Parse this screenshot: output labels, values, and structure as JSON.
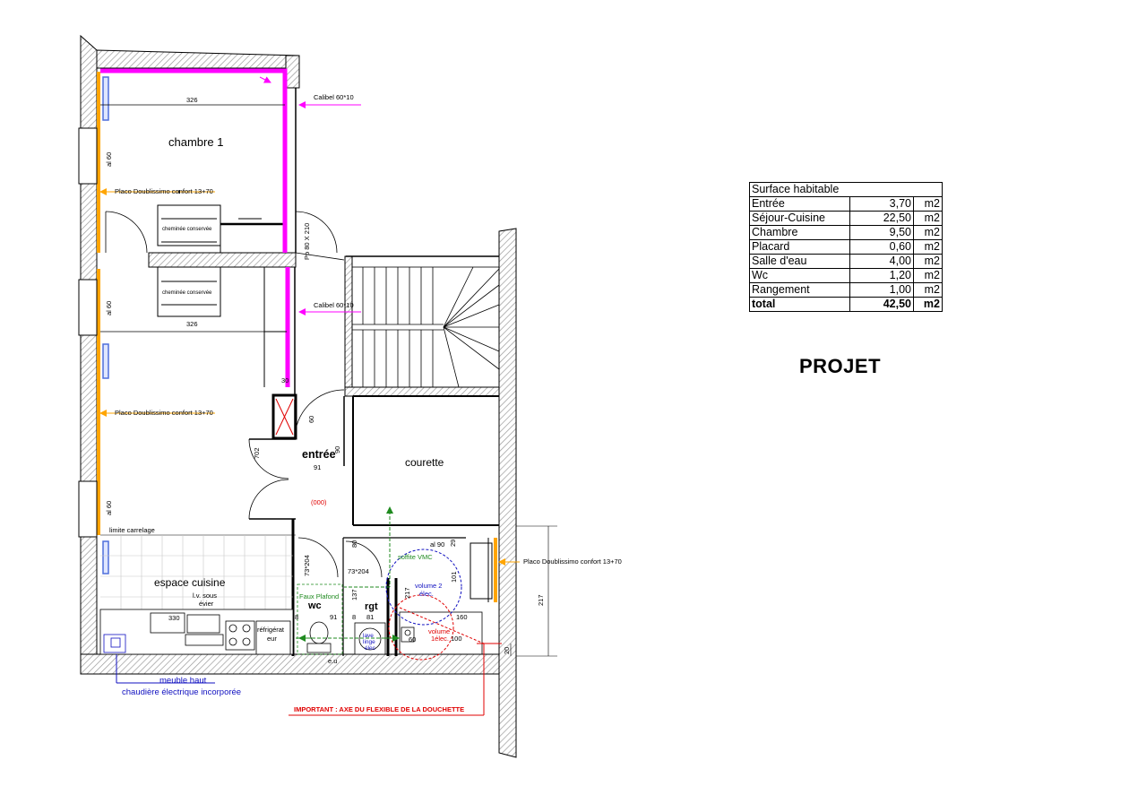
{
  "plan": {
    "rooms": {
      "chambre": "chambre 1",
      "entree": "entrée",
      "courette": "courette",
      "cuisine": "espace cuisine",
      "wc": "wc",
      "sdb": "rgt"
    },
    "dimensions": {
      "d326_top": "326",
      "d326_mid": "326",
      "al60_a": "al 60",
      "al60_b": "al 60",
      "al60_c": "al 60",
      "pp": "Pp 80 X 210",
      "d30": "30",
      "d60": "60",
      "d702": "702",
      "d91_entree": "91",
      "d90_entree": "90",
      "code000": "(000)",
      "d80": "80",
      "al90": "al 90",
      "d29": "29",
      "d73_204_a": "73*204",
      "d73_204_b": "73*204",
      "d137": "137",
      "d217_a": "217",
      "d217_side": "217",
      "d101": "101",
      "d8_a": "8",
      "d91_wc": "91",
      "d8_b": "8",
      "d81": "81",
      "d160": "160",
      "d100": "100",
      "d330": "330",
      "d20": "20",
      "d60_small": "60",
      "eu": "e.u"
    },
    "annotations": {
      "calibel_top": "Calibel 60*10",
      "calibel_mid": "Calibel 60*10",
      "placo_1": "Placo Doublissimo confort 13+70",
      "placo_2": "Placo Doublissimo confort 13+70",
      "placo_3": "Placo Doublissimo confort 13+70",
      "cheminee_1": "cheminée conservée",
      "cheminee_2": "cheminée conservée",
      "limite": "limite carrelage",
      "lv1": "l.v. sous",
      "lv2": "évier",
      "frigo1": "réfrigérat",
      "frigo2": "eur",
      "faux_plafond": "Faux Plafond",
      "soffite": "soffite VMC",
      "volume2_a": "volume 2",
      "volume2_b": "élec.",
      "volume1_a": "volume",
      "volume1_b": "1élec.",
      "lave1": "lave",
      "lave2": "linge",
      "lave3": "élec",
      "meuble_haut": "meuble haut",
      "chaudiere": "chaudière électrique incorporée",
      "important": "IMPORTANT  :  AXE DU FLEXIBLE DE LA DOUCHETTE"
    }
  },
  "surface_table": {
    "title": "Surface habitable",
    "rows": [
      {
        "name": "Entrée",
        "value": "3,70",
        "unit": "m2"
      },
      {
        "name": "Séjour-Cuisine",
        "value": "22,50",
        "unit": "m2"
      },
      {
        "name": "Chambre",
        "value": "9,50",
        "unit": "m2"
      },
      {
        "name": "Placard",
        "value": "0,60",
        "unit": "m2"
      },
      {
        "name": "Salle d'eau",
        "value": "4,00",
        "unit": "m2"
      },
      {
        "name": "Wc",
        "value": "1,20",
        "unit": "m2"
      },
      {
        "name": "Rangement",
        "value": "1,00",
        "unit": "m2"
      }
    ],
    "total": {
      "name": "total",
      "value": "42,50",
      "unit": "m2"
    }
  },
  "projet_label": "PROJET",
  "colors": {
    "wall": "#000000",
    "hatch": "#b5b5b5",
    "calibel": "#ff00ff",
    "placo": "#ffa500",
    "window": "#4f6fdc",
    "soffite": "#1f8a1f",
    "important": "#e00000",
    "meuble": "#1010c0"
  }
}
